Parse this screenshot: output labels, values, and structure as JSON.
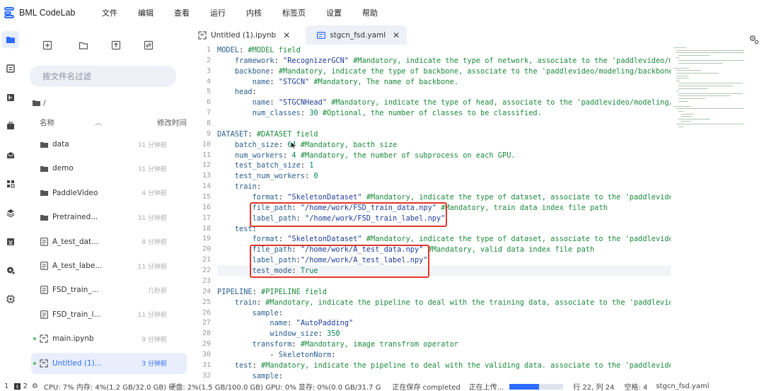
{
  "app": {
    "title": "BML CodeLab"
  },
  "menu": [
    "文件",
    "编辑",
    "查看",
    "运行",
    "内核",
    "标签页",
    "设置",
    "帮助"
  ],
  "activity_icons": [
    "folder-icon",
    "list-icon",
    "debug-icon",
    "toolbox-icon",
    "mail-icon",
    "apps-icon",
    "layers-icon",
    "download-icon",
    "gear-shield-icon",
    "chip-icon"
  ],
  "sidebar": {
    "filter_placeholder": "按文件名过滤",
    "breadcrumb": "/",
    "header_name": "名称",
    "header_mtime": "修改时间",
    "files": [
      {
        "name": "data",
        "time": "31 分钟前",
        "icon": "folder-icon",
        "dot": false,
        "active": false
      },
      {
        "name": "demo",
        "time": "31 分钟前",
        "icon": "folder-icon",
        "dot": false,
        "active": false
      },
      {
        "name": "PaddleVideo",
        "time": "4 分钟前",
        "icon": "folder-icon",
        "dot": false,
        "active": false
      },
      {
        "name": "Pretrained...",
        "time": "31 分钟前",
        "icon": "folder-icon",
        "dot": false,
        "active": false
      },
      {
        "name": "A_test_dat...",
        "time": "8 分钟前",
        "icon": "file-icon",
        "dot": false,
        "active": false
      },
      {
        "name": "A_test_labe...",
        "time": "11 分钟前",
        "icon": "file-icon",
        "dot": false,
        "active": false
      },
      {
        "name": "FSD_train_...",
        "time": "几秒前",
        "icon": "file-icon",
        "dot": false,
        "active": false
      },
      {
        "name": "FSD_train_l...",
        "time": "11 分钟前",
        "icon": "file-icon",
        "dot": false,
        "active": false
      },
      {
        "name": "main.ipynb",
        "time": "9 分钟前",
        "icon": "notebook-icon",
        "dot": true,
        "active": false
      },
      {
        "name": "Untitled (1)...",
        "time": "3 分钟前",
        "icon": "notebook-icon",
        "dot": true,
        "active": true
      }
    ]
  },
  "tabs": [
    {
      "label": "Untitled (1).ipynb",
      "icon": "notebook-icon",
      "active": false
    },
    {
      "label": "stgcn_fsd.yaml",
      "icon": "yaml-icon",
      "active": true
    }
  ],
  "editor": {
    "lines": [
      [
        [
          "k",
          "MODEL"
        ],
        [
          "p",
          ": "
        ],
        [
          "c",
          "#MODEL field"
        ]
      ],
      [
        [
          "p",
          "    "
        ],
        [
          "k",
          "framework"
        ],
        [
          "p",
          ": "
        ],
        [
          "s",
          "\"RecognizerGCN\""
        ],
        [
          "p",
          " "
        ],
        [
          "c",
          "#Mandatory, indicate the type of network, associate to the 'paddlevideo/mo"
        ]
      ],
      [
        [
          "p",
          "    "
        ],
        [
          "k",
          "backbone"
        ],
        [
          "p",
          ": "
        ],
        [
          "c",
          "#Mandatory, indicate the type of backbone, associate to the 'paddlevideo/modeling/backbones"
        ]
      ],
      [
        [
          "p",
          "        "
        ],
        [
          "k",
          "name"
        ],
        [
          "p",
          ": "
        ],
        [
          "s",
          "\"STGCN\""
        ],
        [
          "p",
          " "
        ],
        [
          "c",
          "#Mandatory, The name of backbone."
        ]
      ],
      [
        [
          "p",
          "    "
        ],
        [
          "k",
          "head"
        ],
        [
          "p",
          ":"
        ]
      ],
      [
        [
          "p",
          "        "
        ],
        [
          "k",
          "name"
        ],
        [
          "p",
          ": "
        ],
        [
          "s",
          "\"STGCNHead\""
        ],
        [
          "p",
          " "
        ],
        [
          "c",
          "#Mandatory, indicate the type of head, associate to the 'paddlevideo/modeling/h"
        ]
      ],
      [
        [
          "p",
          "        "
        ],
        [
          "k",
          "num_classes"
        ],
        [
          "p",
          ": "
        ],
        [
          "n",
          "30"
        ],
        [
          "p",
          " "
        ],
        [
          "c",
          "#Optional, the number of classes to be classified."
        ]
      ],
      [],
      [
        [
          "k",
          "DATASET"
        ],
        [
          "p",
          ": "
        ],
        [
          "c",
          "#DATASET field"
        ]
      ],
      [
        [
          "p",
          "    "
        ],
        [
          "k",
          "batch_size"
        ],
        [
          "p",
          ": "
        ],
        [
          "n",
          "64"
        ],
        [
          "p",
          " "
        ],
        [
          "c",
          "#Mandatory, bacth size"
        ]
      ],
      [
        [
          "p",
          "    "
        ],
        [
          "k",
          "num_workers"
        ],
        [
          "p",
          ": "
        ],
        [
          "n",
          "4"
        ],
        [
          "p",
          " "
        ],
        [
          "c",
          "#Mandatory, the number of subprocess on each GPU."
        ]
      ],
      [
        [
          "p",
          "    "
        ],
        [
          "k",
          "test_batch_size"
        ],
        [
          "p",
          ": "
        ],
        [
          "n",
          "1"
        ]
      ],
      [
        [
          "p",
          "    "
        ],
        [
          "k",
          "test_num_workers"
        ],
        [
          "p",
          ": "
        ],
        [
          "n",
          "0"
        ]
      ],
      [
        [
          "p",
          "    "
        ],
        [
          "k",
          "train"
        ],
        [
          "p",
          ":"
        ]
      ],
      [
        [
          "p",
          "        "
        ],
        [
          "k",
          "format"
        ],
        [
          "p",
          ": "
        ],
        [
          "s",
          "\"SkeletonDataset\""
        ],
        [
          "p",
          " "
        ],
        [
          "c",
          "#Mandatory, indicate the type of dataset, associate to the 'paddlevide"
        ]
      ],
      [
        [
          "p",
          "        "
        ],
        [
          "k",
          "file_path"
        ],
        [
          "p",
          ": "
        ],
        [
          "s",
          "\"/home/work/FSD_train_data.npy\""
        ],
        [
          "p",
          " "
        ],
        [
          "c",
          "#Mandatory, train data index file path"
        ]
      ],
      [
        [
          "p",
          "        "
        ],
        [
          "k",
          "label_path"
        ],
        [
          "p",
          ": "
        ],
        [
          "s",
          "\"/home/work/FSD_train_label.npy\""
        ]
      ],
      [
        [
          "p",
          "    "
        ],
        [
          "k",
          "test"
        ],
        [
          "p",
          ":"
        ]
      ],
      [
        [
          "p",
          "        "
        ],
        [
          "k",
          "format"
        ],
        [
          "p",
          ": "
        ],
        [
          "s",
          "\"SkeletonDataset\""
        ],
        [
          "p",
          " "
        ],
        [
          "c",
          "#Mandatory, indicate the type of dataset, associate to the 'paddlevide"
        ]
      ],
      [
        [
          "p",
          "        "
        ],
        [
          "k",
          "file_path"
        ],
        [
          "p",
          ": "
        ],
        [
          "s",
          "\"/home/work/A_test_data.npy\""
        ],
        [
          "p",
          " "
        ],
        [
          "c",
          "#Mandatory, valid data index file path"
        ]
      ],
      [
        [
          "p",
          "        "
        ],
        [
          "k",
          "label_path"
        ],
        [
          "p",
          ":"
        ],
        [
          "s",
          "\"/home/work/A_test_label.npy\""
        ]
      ],
      [
        [
          "p",
          "        "
        ],
        [
          "k",
          "test_mode"
        ],
        [
          "p",
          ": "
        ],
        [
          "n",
          "True"
        ]
      ],
      [],
      [
        [
          "k",
          "PIPELINE"
        ],
        [
          "p",
          ": "
        ],
        [
          "c",
          "#PIPELINE field"
        ]
      ],
      [
        [
          "p",
          "    "
        ],
        [
          "k",
          "train"
        ],
        [
          "p",
          ": "
        ],
        [
          "c",
          "#Mandotary, indicate the pipeline to deal with the training data, associate to the 'paddlevide"
        ]
      ],
      [
        [
          "p",
          "        "
        ],
        [
          "k",
          "sample"
        ],
        [
          "p",
          ":"
        ]
      ],
      [
        [
          "p",
          "            "
        ],
        [
          "k",
          "name"
        ],
        [
          "p",
          ": "
        ],
        [
          "s",
          "\"AutoPadding\""
        ]
      ],
      [
        [
          "p",
          "            "
        ],
        [
          "k",
          "window_size"
        ],
        [
          "p",
          ": "
        ],
        [
          "n",
          "350"
        ]
      ],
      [
        [
          "p",
          "        "
        ],
        [
          "k",
          "transform"
        ],
        [
          "p",
          ": "
        ],
        [
          "c",
          "#Mandotary, image transfrom operator"
        ]
      ],
      [
        [
          "p",
          "            - "
        ],
        [
          "k",
          "SkeletonNorm"
        ],
        [
          "p",
          ":"
        ]
      ],
      [
        [
          "p",
          "    "
        ],
        [
          "k",
          "test"
        ],
        [
          "p",
          ": "
        ],
        [
          "c",
          "#Mandatory, indicate the pipeline to deal with the validing data. associate to the 'paddlevide"
        ]
      ],
      [
        [
          "p",
          "        "
        ],
        [
          "k",
          "sample"
        ],
        [
          "p",
          ":"
        ]
      ]
    ]
  },
  "status": {
    "left1": "1",
    "badge": "s",
    "left2": "2",
    "resources": "CPU: 7% 内存: 4%(1.2 GB/32.0 GB) 硬盘: 2%(1.5 GB/100.0 GB) GPU: 0% 显存: 0%(0.0 GB/31.7 G",
    "saving": "正在保存 completed",
    "uploading": "正在上传...",
    "upload_progress": 0.55,
    "cursor": "行 22, 列 24",
    "indent": "空格: 4",
    "filename": "stgcn_fsd.yaml"
  },
  "colors": {
    "accent": "#2f6bff",
    "highlight_box": "#e0362b",
    "active_bg": "#e8eefc"
  }
}
